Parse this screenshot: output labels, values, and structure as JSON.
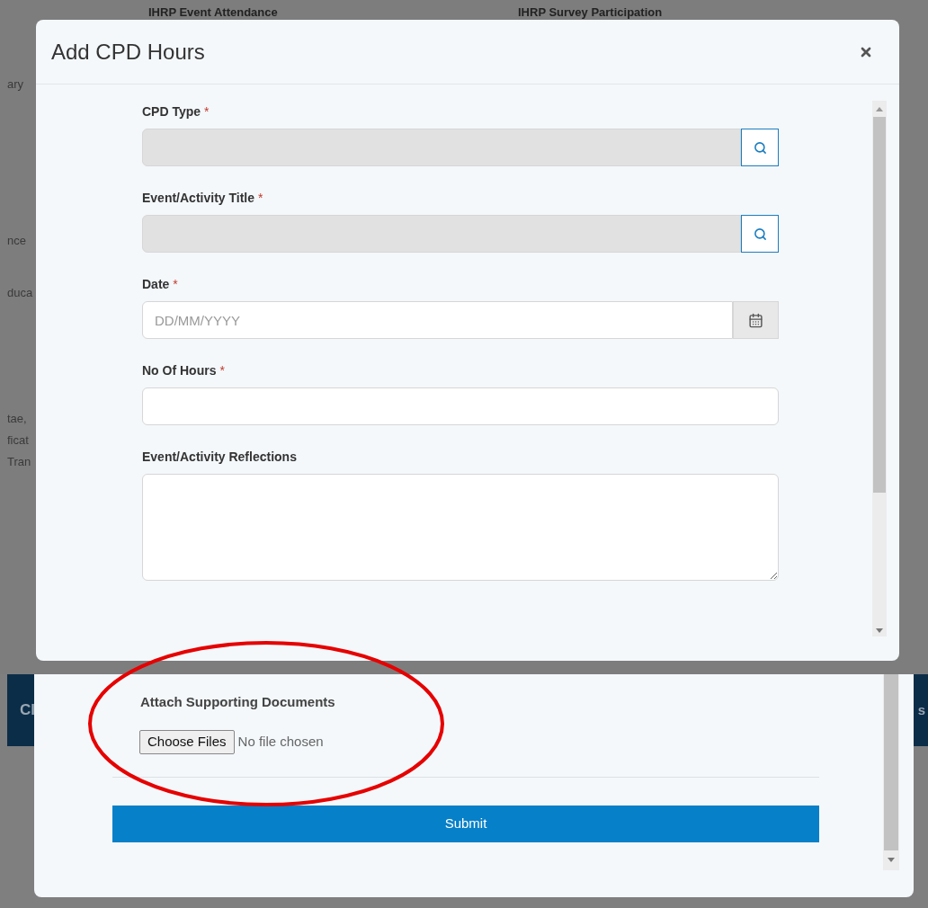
{
  "background": {
    "columns": [
      "IHRP Event Attendance",
      "IHRP Survey Participation"
    ],
    "side_texts": [
      "ary",
      "nce",
      "duca",
      "tae,",
      "ficat",
      "Tran"
    ]
  },
  "modal": {
    "title": "Add CPD Hours",
    "required_mark": "*",
    "fields": [
      {
        "kind": "lookup",
        "label": "CPD Type",
        "required": true
      },
      {
        "kind": "lookup",
        "label": "Event/Activity Title",
        "required": true
      },
      {
        "kind": "date",
        "label": "Date",
        "required": true,
        "placeholder": "DD/MM/YYYY"
      },
      {
        "kind": "text",
        "label": "No Of Hours",
        "required": true
      },
      {
        "kind": "textarea",
        "label": "Event/Activity Reflections",
        "required": false
      }
    ]
  },
  "lower": {
    "banner_texts": [
      "Cl",
      "s"
    ],
    "attach": {
      "label": "Attach Supporting Documents",
      "button": "Choose Files",
      "status": "No file chosen"
    },
    "submit": "Submit"
  }
}
